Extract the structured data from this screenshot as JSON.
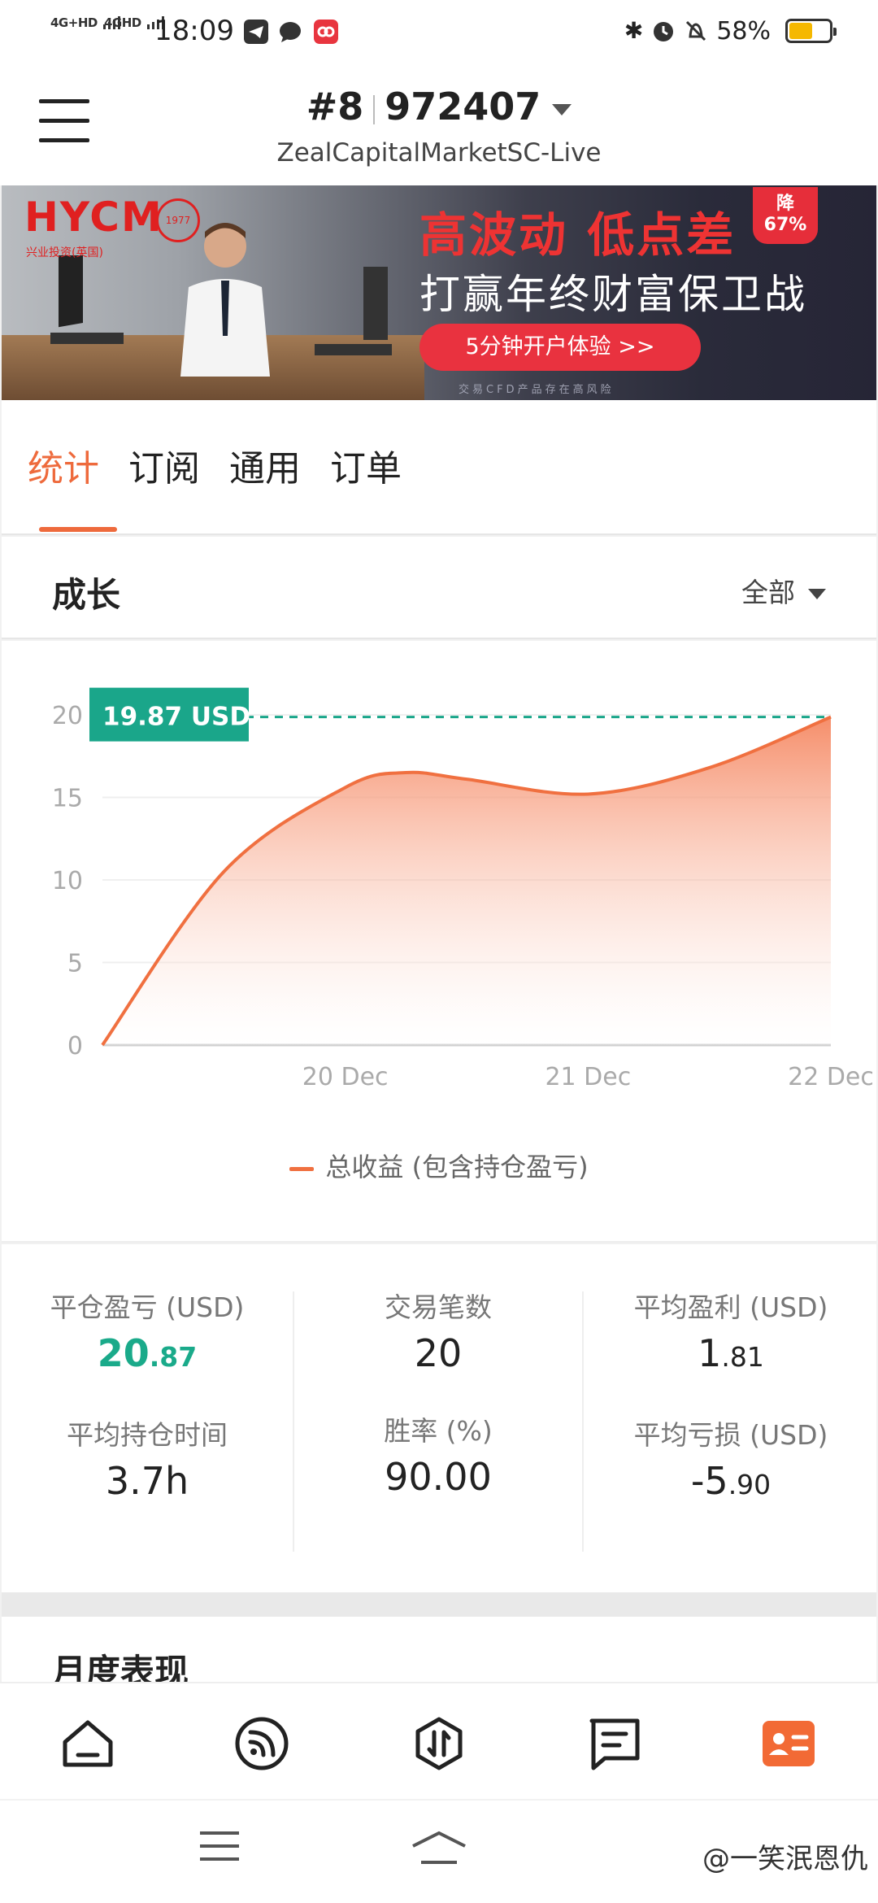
{
  "status_bar": {
    "network1": "4G+HD",
    "network2": "4GHD",
    "time": "18:09",
    "battery_percent": "58%",
    "battery_level": 0.58,
    "icons": [
      "telegram-icon",
      "chat-bubble-icon",
      "app-icon",
      "bluetooth-icon",
      "alarm-icon",
      "mute-icon"
    ]
  },
  "header": {
    "account_index": "#8",
    "account_number": "972407",
    "server": "ZealCapitalMarketSC-Live"
  },
  "banner": {
    "brand": "HYCM",
    "brand_sub": "兴业投资(英国)",
    "seal_text": "1977",
    "headline": "高波动 低点差",
    "subline": "打赢年终财富保卫战",
    "badge_line1": "降",
    "badge_line2": "67%",
    "cta": "5分钟开户体验 >>",
    "disclaimer": "交易CFD产品存在高风险"
  },
  "tabs": [
    {
      "label": "统计",
      "active": true
    },
    {
      "label": "订阅",
      "active": false
    },
    {
      "label": "通用",
      "active": false
    },
    {
      "label": "订单",
      "active": false
    }
  ],
  "growth": {
    "title": "成长",
    "range_label": "全部"
  },
  "chart_data": {
    "type": "area",
    "x": [
      "19 Dec",
      "19.5",
      "20 Dec",
      "20.25",
      "20.5",
      "21 Dec",
      "21.5",
      "22 Dec"
    ],
    "x_tick_labels": [
      "20 Dec",
      "21 Dec",
      "22 Dec"
    ],
    "y_ticks": [
      "0",
      "5",
      "10",
      "15",
      "20"
    ],
    "ylim": [
      0,
      20
    ],
    "series": [
      {
        "name": "总收益 (包含持仓盈亏)",
        "values": [
          0,
          10.5,
          15.6,
          16.5,
          16.1,
          15.2,
          16.8,
          19.87
        ]
      }
    ],
    "current_value_label": "19.87 USD",
    "current_value": 19.87,
    "line_color": "#f07040",
    "marker_color": "#1aa68a",
    "legend_position": "bottom"
  },
  "stats": {
    "closed_pnl_label": "平仓盈亏 (USD)",
    "closed_pnl_int": "20",
    "closed_pnl_dec": ".87",
    "trade_count_label": "交易笔数",
    "trade_count": "20",
    "avg_profit_label": "平均盈利 (USD)",
    "avg_profit_int": "1",
    "avg_profit_dec": ".81",
    "avg_hold_label": "平均持仓时间",
    "avg_hold": "3.7h",
    "win_rate_label": "胜率 (%)",
    "win_rate": "90.00",
    "avg_loss_label": "平均亏损 (USD)",
    "avg_loss_int": "-5",
    "avg_loss_dec": ".90"
  },
  "monthly": {
    "title": "月度表现"
  },
  "bottom_nav": [
    {
      "icon": "home-icon",
      "active": false
    },
    {
      "icon": "signal-feed-icon",
      "active": false
    },
    {
      "icon": "trade-icon",
      "active": false
    },
    {
      "icon": "message-icon",
      "active": false
    },
    {
      "icon": "profile-card-icon",
      "active": true
    }
  ],
  "watermark": "@一笑泯恩仇",
  "colors": {
    "accent": "#ee6a3c",
    "profit_green": "#1aaa8a"
  }
}
